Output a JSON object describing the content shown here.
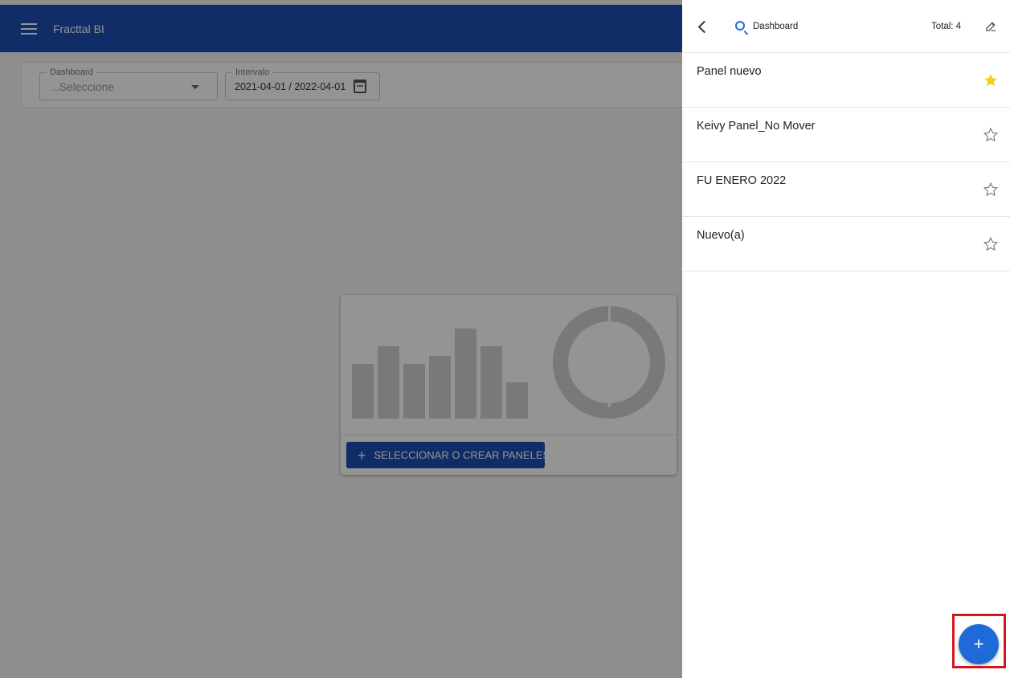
{
  "app": {
    "title": "Fracttal BI"
  },
  "filters": {
    "dashboard_label": "Dashboard",
    "dashboard_value": "...Seleccione",
    "interval_label": "Intervalo",
    "interval_value": "2021-04-01 / 2022-04-01"
  },
  "empty_state": {
    "button_label": "SELECCIONAR O CREAR PANELES",
    "button_icon": "plus-icon"
  },
  "panel": {
    "search_text": "Dashboard",
    "total": "Total: 4",
    "items": [
      {
        "label": "Panel nuevo",
        "favorite": true
      },
      {
        "label": "Keivy Panel_No Mover",
        "favorite": false
      },
      {
        "label": "FU ENERO 2022",
        "favorite": false
      },
      {
        "label": "Nuevo(a)",
        "favorite": false
      }
    ]
  },
  "fab": {
    "label": "+"
  },
  "colors": {
    "primary": "#1e4fb3",
    "accent": "#1e6ad8",
    "favorite_star": "#f2cf1e",
    "highlight": "#d6141c"
  }
}
